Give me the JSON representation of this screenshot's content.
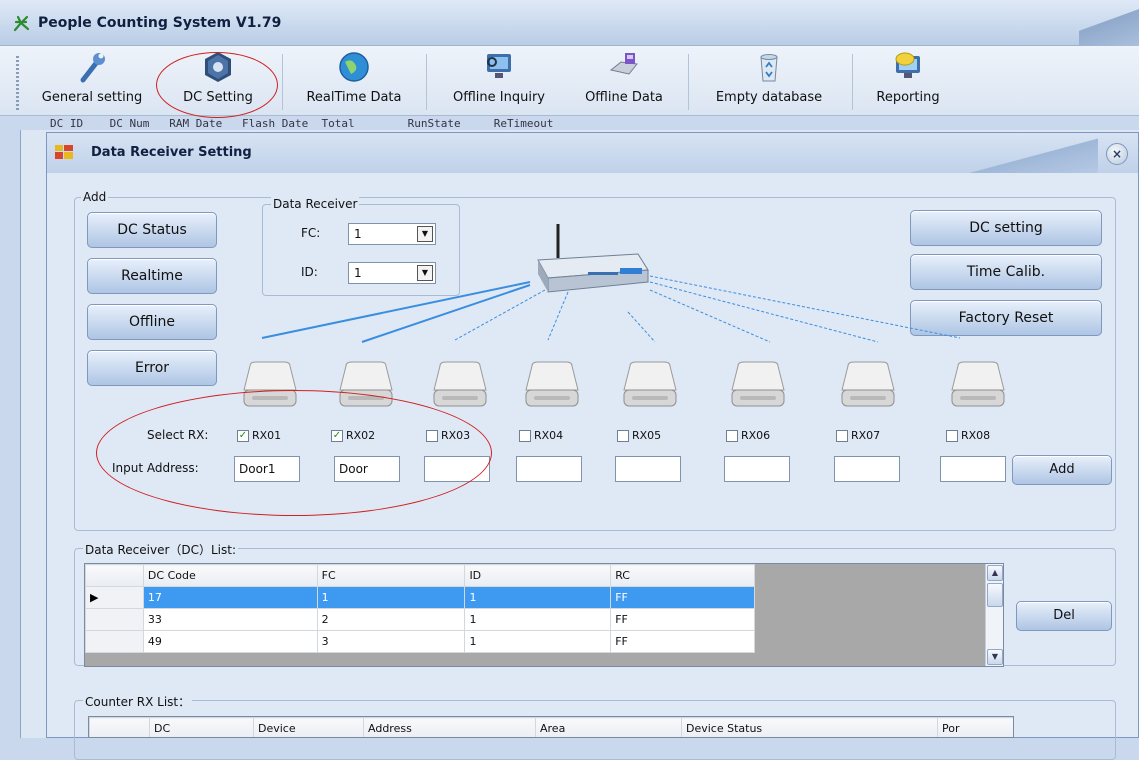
{
  "app": {
    "title": "People Counting System V1.79"
  },
  "toolbar": [
    {
      "label": "General setting",
      "icon": "wrench-icon"
    },
    {
      "label": "DC Setting",
      "icon": "hex-nut-icon"
    },
    {
      "label": "RealTime Data",
      "icon": "globe-icon"
    },
    {
      "label": "Offline Inquiry",
      "icon": "monitor-search-icon"
    },
    {
      "label": "Offline Data",
      "icon": "disk-drive-icon"
    },
    {
      "label": "Empty database",
      "icon": "recycle-bin-icon"
    },
    {
      "label": "Reporting",
      "icon": "monitor-chat-icon"
    }
  ],
  "background_columns": "DC ID    DC Num   RAM Date   Flash Date  Total        RunState     ReTimeout",
  "dialog": {
    "title": "Data Receiver Setting",
    "close": "×",
    "add_group": "Add",
    "left_buttons": [
      "DC Status",
      "Realtime",
      "Offline",
      "Error"
    ],
    "right_buttons": [
      "DC setting",
      "Time Calib.",
      "Factory Reset"
    ],
    "data_receiver": {
      "legend": "Data Receiver",
      "fc_label": "FC:",
      "fc_value": "1",
      "id_label": "ID:",
      "id_value": "1"
    },
    "select_rx_label": "Select RX:",
    "input_address_label": "Input Address:",
    "rx": [
      {
        "name": "RX01",
        "checked": true,
        "address": "Door1"
      },
      {
        "name": "RX02",
        "checked": true,
        "address": "Door"
      },
      {
        "name": "RX03",
        "checked": false,
        "address": ""
      },
      {
        "name": "RX04",
        "checked": false,
        "address": ""
      },
      {
        "name": "RX05",
        "checked": false,
        "address": ""
      },
      {
        "name": "RX06",
        "checked": false,
        "address": ""
      },
      {
        "name": "RX07",
        "checked": false,
        "address": ""
      },
      {
        "name": "RX08",
        "checked": false,
        "address": ""
      }
    ],
    "add_button": "Add",
    "dc_list": {
      "legend": "Data Receiver（DC）List:",
      "columns": [
        "DC Code",
        "FC",
        "ID",
        "RC"
      ],
      "rows": [
        {
          "dc_code": "17",
          "fc": "1",
          "id": "1",
          "rc": "FF",
          "selected": true
        },
        {
          "dc_code": "33",
          "fc": "2",
          "id": "1",
          "rc": "FF",
          "selected": false
        },
        {
          "dc_code": "49",
          "fc": "3",
          "id": "1",
          "rc": "FF",
          "selected": false
        }
      ],
      "del_button": "Del"
    },
    "counter_list": {
      "legend": "Counter RX List：",
      "columns": [
        "DC",
        "Device",
        "Address",
        "Area",
        "Device Status",
        "Por"
      ]
    }
  },
  "colors": {
    "selection": "#3d9af0",
    "annotation": "#d02020",
    "title_text": "#102040"
  }
}
